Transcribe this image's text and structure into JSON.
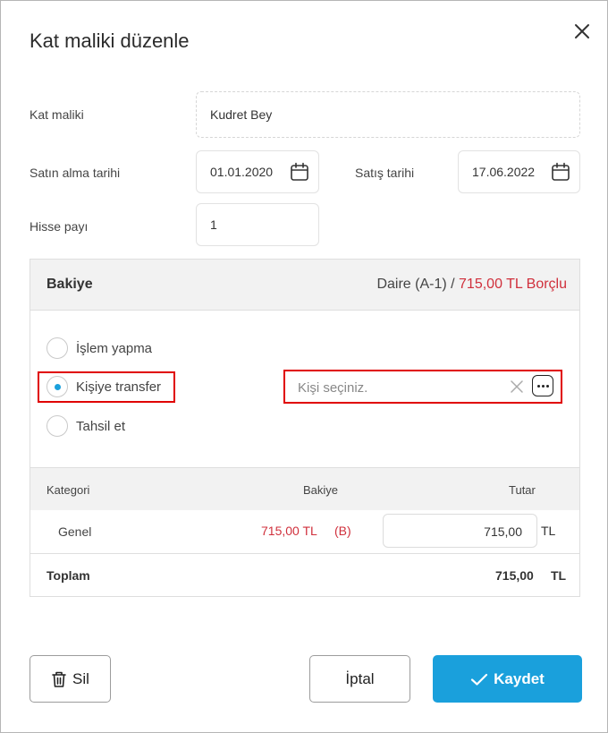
{
  "dialog": {
    "title": "Kat maliki düzenle",
    "close_icon": "close-icon"
  },
  "form": {
    "owner_label": "Kat maliki",
    "owner_value": "Kudret Bey",
    "purchase_label": "Satın alma tarihi",
    "purchase_value": "01.01.2020",
    "sale_label": "Satış tarihi",
    "sale_value": "17.06.2022",
    "share_label": "Hisse payı",
    "share_value": "1"
  },
  "balance": {
    "title": "Bakiye",
    "unit": "Daire (A-1) /",
    "amount_status": "715,00 TL Borçlu",
    "options": [
      {
        "label": "İşlem yapma",
        "checked": false
      },
      {
        "label": "Kişiye transfer",
        "checked": true
      },
      {
        "label": "Tahsil et",
        "checked": false
      }
    ],
    "person_placeholder": "Kişi seçiniz."
  },
  "table": {
    "headers": [
      "Kategori",
      "Bakiye",
      "Tutar"
    ],
    "rows": [
      {
        "category": "Genel",
        "balance": "715,00 TL",
        "balance_flag": "(B)",
        "amount": "715,00",
        "currency": "TL"
      }
    ],
    "total_label": "Toplam",
    "total_value": "715,00",
    "total_currency": "TL"
  },
  "buttons": {
    "delete": "Sil",
    "cancel": "İptal",
    "save": "Kaydet"
  },
  "colors": {
    "accent": "#1aa0dc",
    "debt": "#d0303c",
    "highlight": "#e00000"
  }
}
